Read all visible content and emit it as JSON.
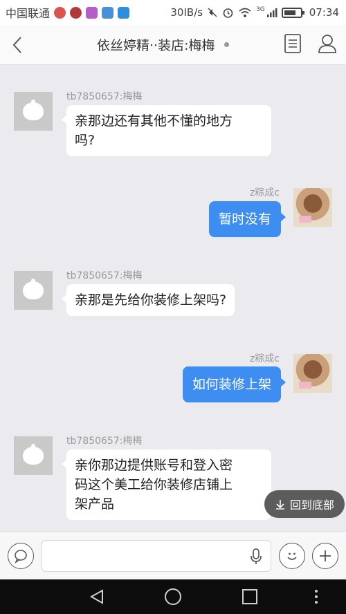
{
  "status_bar": {
    "carrier": "中国联通",
    "speed": "30IB/s",
    "network": "3G",
    "time": "07:34",
    "app_icon_colors": [
      "#d9534f",
      "#b03a3a",
      "#b35ec9",
      "#4a8fd9",
      "#2f8de0"
    ]
  },
  "header": {
    "title": "依丝婷精··装店:梅梅"
  },
  "messages": [
    {
      "side": "left",
      "sender": "tb7850657:梅梅",
      "lines": [
        "亲那边还有其他不懂的地方",
        "吗?"
      ]
    },
    {
      "side": "right",
      "sender": "z粽成c",
      "lines": [
        "暂时没有"
      ]
    },
    {
      "side": "left",
      "sender": "tb7850657:梅梅",
      "lines": [
        "亲那是先给你装修上架吗?"
      ]
    },
    {
      "side": "right",
      "sender": "z粽成c",
      "lines": [
        "如何装修上架"
      ]
    },
    {
      "side": "left",
      "sender": "tb7850657:梅梅",
      "lines": [
        "亲你那边提供账号和登入密",
        "码这个美工给你装修店铺上",
        "架产品"
      ]
    }
  ],
  "scroll_to_bottom": {
    "label": "回到底部"
  },
  "input": {
    "placeholder": ""
  },
  "colors": {
    "accent": "#3d8ef0",
    "chat_bg": "#eaeaef"
  }
}
